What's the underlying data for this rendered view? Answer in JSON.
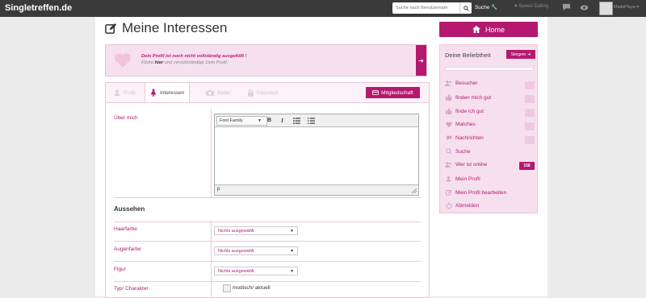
{
  "topbar": {
    "brand": "Singletreffen.de",
    "search_placeholder": "Suche nach Benutzernam",
    "search_label": "Suche",
    "speed_dating": "Speed-Dating",
    "username": "MailaPlaya"
  },
  "page": {
    "title": "Meine Interessen",
    "warning_line1": "Dein Profil ist noch nicht vollständig ausgefüllt !",
    "warning_pre": "Klicke ",
    "warning_link": "hier",
    "warning_post": " und vervollständige Dein Profil."
  },
  "tabs": [
    {
      "label": "Profil",
      "icon": "user-icon"
    },
    {
      "label": "Interessen",
      "icon": "female-icon"
    },
    {
      "label": "Bilder",
      "icon": "camera-icon"
    },
    {
      "label": "Passwort",
      "icon": "lock-icon"
    }
  ],
  "membership_button": "Mitgliedschaft",
  "form": {
    "about_label": "Über mich",
    "editor_font": "Font Family",
    "editor_status": "p",
    "section_title": "Aussehen",
    "fields": [
      {
        "label": "Haarfarbe",
        "value": "Nichts ausgewählt"
      },
      {
        "label": "Augenfarbe",
        "value": "Nichts ausgewählt"
      },
      {
        "label": "Figur",
        "value": "Nichts ausgewählt"
      }
    ],
    "typ_label": "Typ/ Charakter",
    "typ_option": "modisch/ aktuell"
  },
  "sidebar": {
    "home_label": "Home",
    "title": "Deine Beliebtheit",
    "steigern": "Steigern",
    "popularity_fraction": 0.0,
    "items": [
      {
        "label": "Besucher",
        "icon": "users-icon",
        "badge": ""
      },
      {
        "label": "finden mich gut",
        "icon": "thumbs-up-icon",
        "badge": ""
      },
      {
        "label": "finde ich gut",
        "icon": "thumbs-up-icon",
        "badge": ""
      },
      {
        "label": "Matches",
        "icon": "heart-icon",
        "badge": ""
      },
      {
        "label": "Nachrichten",
        "icon": "chat-icon",
        "badge": ""
      },
      {
        "label": "Suche",
        "icon": "search-icon"
      },
      {
        "label": "Wer ist online",
        "icon": "users-icon",
        "badge": "158"
      },
      {
        "label": "Mein Profil",
        "icon": "user-icon"
      },
      {
        "label": "Mein Profil bearbeiten",
        "icon": "edit-icon"
      },
      {
        "label": "Abmelden",
        "icon": "power-icon"
      }
    ]
  },
  "colors": {
    "accent": "#b5196f",
    "pale": "#f6e0ee",
    "topbar": "#3a3a3a"
  }
}
